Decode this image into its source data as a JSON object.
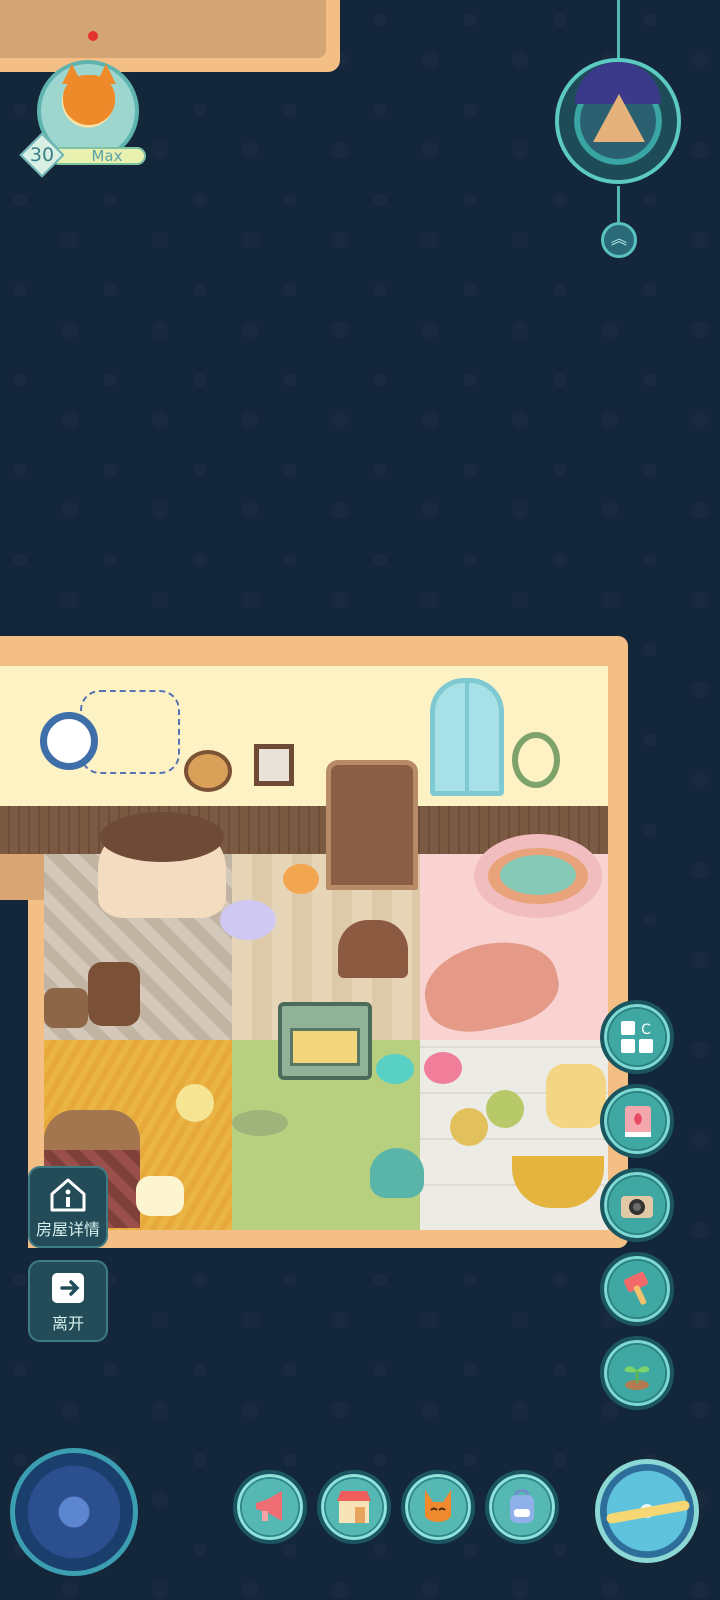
{
  "player": {
    "level": "30",
    "name": "Max"
  },
  "left_buttons": {
    "house_details": "房屋详情",
    "leave": "离开"
  },
  "icons": {
    "house_info": "house-info-icon",
    "exit": "exit-icon",
    "layout": "layout-grid-icon",
    "book": "tulip-book-icon",
    "camera": "camera-icon",
    "hammer": "hammer-icon",
    "sprout": "sprout-icon",
    "megaphone": "megaphone-icon",
    "shop": "shop-stall-icon",
    "friend": "fox-friend-icon",
    "backpack": "backpack-icon",
    "astrolabe": "astrolabe-icon",
    "compass": "compass-icon",
    "expand": "double-chevron-up-icon",
    "tent": "tent-emblem-icon"
  },
  "colors": {
    "background": "#14263a",
    "house_border": "#f3bf84",
    "button_teal": "#3fa8a3"
  }
}
